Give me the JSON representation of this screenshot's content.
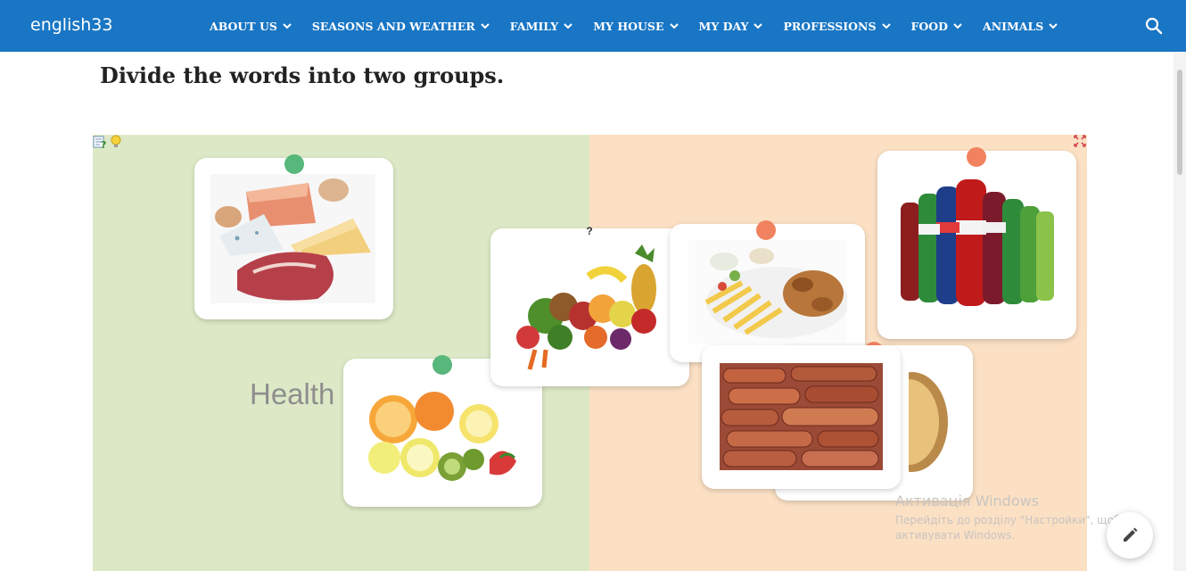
{
  "brand": "english33",
  "nav": {
    "items": [
      {
        "label": "ABOUT US"
      },
      {
        "label": "SEASONS AND WEATHER"
      },
      {
        "label": "FAMILY"
      },
      {
        "label": "MY HOUSE"
      },
      {
        "label": "MY DAY"
      },
      {
        "label": "PROFESSIONS"
      },
      {
        "label": "FOOD"
      },
      {
        "label": "ANIMALS"
      }
    ]
  },
  "page": {
    "heading": "Divide the words into two groups."
  },
  "activity": {
    "group_label_left": "Health",
    "card_question_mark": "?"
  },
  "watermark": {
    "title": "Активація Windows",
    "line1": "Перейдіть до розділу \"Настройки\", щоб",
    "line2": "активувати Windows."
  },
  "colors": {
    "nav_bg": "#1976c4",
    "healthy_bg": "#dde9c6",
    "unhealthy_bg": "#fbe0c4",
    "pin_green": "#58b77a",
    "pin_red": "#f08260"
  }
}
